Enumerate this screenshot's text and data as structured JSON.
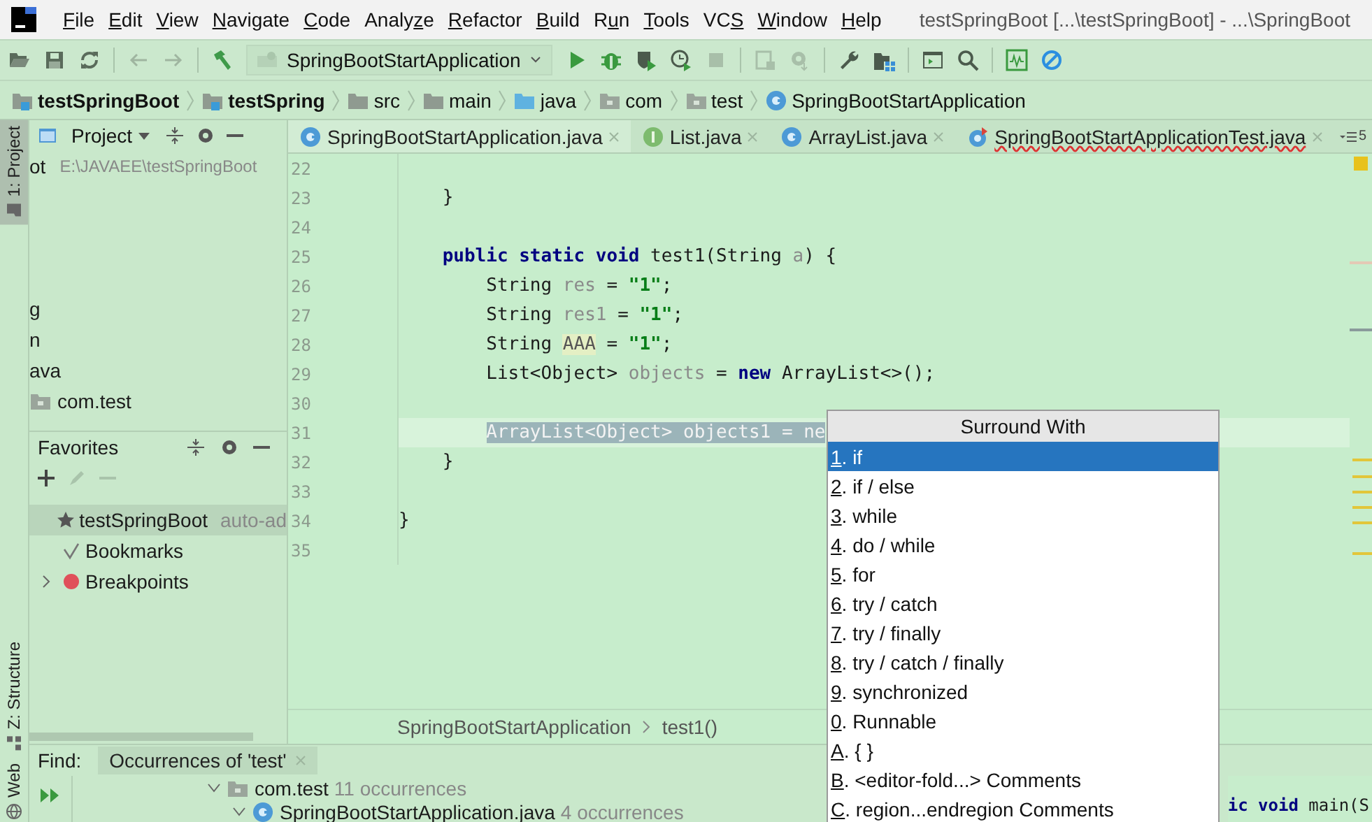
{
  "window": {
    "title": "testSpringBoot [...\\testSpringBoot] - ...\\SpringBoot"
  },
  "menu": [
    {
      "key": "F",
      "after": "ile"
    },
    {
      "key": "E",
      "after": "dit"
    },
    {
      "key": "V",
      "after": "iew"
    },
    {
      "key": "N",
      "after": "avigate"
    },
    {
      "key": "C",
      "after": "ode"
    },
    {
      "before": "Analy",
      "key": "z",
      "after": "e"
    },
    {
      "key": "R",
      "after": "efactor"
    },
    {
      "key": "B",
      "after": "uild"
    },
    {
      "before": "R",
      "key": "u",
      "after": "n"
    },
    {
      "key": "T",
      "after": "ools"
    },
    {
      "before": "VC",
      "key": "S"
    },
    {
      "key": "W",
      "after": "indow"
    },
    {
      "key": "H",
      "after": "elp"
    }
  ],
  "toolbar": {
    "run_config": "SpringBootStartApplication"
  },
  "breadcrumbs": [
    {
      "label": "testSpringBoot",
      "kind": "module"
    },
    {
      "label": "testSpring",
      "kind": "module"
    },
    {
      "label": "src",
      "kind": "folder"
    },
    {
      "label": "main",
      "kind": "folder"
    },
    {
      "label": "java",
      "kind": "source"
    },
    {
      "label": "com",
      "kind": "package"
    },
    {
      "label": "test",
      "kind": "package"
    },
    {
      "label": "SpringBootStartApplication",
      "kind": "class"
    }
  ],
  "tool_stripe": [
    {
      "label": "1: Project",
      "at_bottom": false,
      "selected": true
    },
    {
      "label": "Z: Structure",
      "at_bottom": true,
      "selected": false
    },
    {
      "label": "Web",
      "at_bottom": true,
      "selected": false
    }
  ],
  "project_panel": {
    "title": "Project",
    "rows": [
      {
        "name": "ot",
        "path": "E:\\JAVAEE\\testSpringBoot"
      },
      {
        "name": "g"
      },
      {
        "name": "n"
      },
      {
        "name": "ava"
      },
      {
        "name": "com.test",
        "kind": "package"
      }
    ]
  },
  "favorites": {
    "title": "Favorites",
    "items": [
      {
        "label": "testSpringBoot",
        "note": "auto-ad",
        "kind": "star",
        "selected": true
      },
      {
        "label": "Bookmarks",
        "kind": "check",
        "selected": false
      },
      {
        "label": "Breakpoints",
        "kind": "breakpoint",
        "selected": false,
        "expanded": false
      }
    ]
  },
  "editor": {
    "tabs": [
      {
        "label": "SpringBootStartApplication.java",
        "kind": "class",
        "selected": true,
        "has_errors": false
      },
      {
        "label": "List.java",
        "kind": "interface",
        "selected": false,
        "has_errors": false
      },
      {
        "label": "ArrayList.java",
        "kind": "class",
        "selected": false,
        "has_errors": false
      },
      {
        "label": "SpringBootStartApplicationTest.java",
        "kind": "test",
        "selected": false,
        "has_errors": true
      }
    ],
    "hidden_tabs": "5",
    "lines": [
      {
        "number": "22",
        "current": false
      },
      {
        "number": "23",
        "current": false,
        "tokens": [
          {
            "text": "    }",
            "kind": "plain"
          }
        ]
      },
      {
        "number": "24",
        "current": false
      },
      {
        "number": "25",
        "current": false,
        "tokens": [
          {
            "text": "    public static void",
            "kind": "keyword"
          },
          {
            "text": " test1(String ",
            "kind": "plain"
          },
          {
            "text": "a",
            "kind": "unused"
          },
          {
            "text": ") {",
            "kind": "plain"
          }
        ]
      },
      {
        "number": "26",
        "current": false,
        "tokens": [
          {
            "text": "        String ",
            "kind": "plain"
          },
          {
            "text": "res",
            "kind": "unused"
          },
          {
            "text": " = ",
            "kind": "plain"
          },
          {
            "text": "\"1\"",
            "kind": "string"
          },
          {
            "text": ";",
            "kind": "plain"
          }
        ]
      },
      {
        "number": "27",
        "current": false,
        "tokens": [
          {
            "text": "        String ",
            "kind": "plain"
          },
          {
            "text": "res1",
            "kind": "unused"
          },
          {
            "text": " = ",
            "kind": "plain"
          },
          {
            "text": "\"1\"",
            "kind": "string"
          },
          {
            "text": ";",
            "kind": "plain"
          }
        ]
      },
      {
        "number": "28",
        "current": false,
        "tokens": [
          {
            "text": "        String ",
            "kind": "plain"
          },
          {
            "text": "AAA",
            "kind": "warning"
          },
          {
            "text": " = ",
            "kind": "plain"
          },
          {
            "text": "\"1\"",
            "kind": "string"
          },
          {
            "text": ";",
            "kind": "plain"
          }
        ]
      },
      {
        "number": "29",
        "current": false,
        "tokens": [
          {
            "text": "        List<Object> ",
            "kind": "plain"
          },
          {
            "text": "objects",
            "kind": "unused"
          },
          {
            "text": " = ",
            "kind": "plain"
          },
          {
            "text": "new",
            "kind": "keyword"
          },
          {
            "text": " ArrayList<>();",
            "kind": "plain"
          }
        ]
      },
      {
        "number": "30",
        "current": false
      },
      {
        "number": "31",
        "current": true,
        "tokens": [
          {
            "text": "        ArrayList<Object> objects1 = ne",
            "kind": "selected"
          }
        ]
      },
      {
        "number": "32",
        "current": false,
        "tokens": [
          {
            "text": "    }",
            "kind": "plain"
          }
        ]
      },
      {
        "number": "33",
        "current": false
      },
      {
        "number": "34",
        "current": false,
        "tokens": [
          {
            "text": "}",
            "kind": "plain"
          }
        ]
      },
      {
        "number": "35",
        "current": false
      }
    ],
    "breadcrumbs": [
      "SpringBootStartApplication",
      "test1()"
    ]
  },
  "popup": {
    "title": "Surround With",
    "items": [
      {
        "key": "1",
        "label": ". if",
        "selected": true
      },
      {
        "key": "2",
        "label": ". if / else",
        "selected": false
      },
      {
        "key": "3",
        "label": ". while",
        "selected": false
      },
      {
        "key": "4",
        "label": ". do / while",
        "selected": false
      },
      {
        "key": "5",
        "label": ". for",
        "selected": false
      },
      {
        "key": "6",
        "label": ". try / catch",
        "selected": false
      },
      {
        "key": "7",
        "label": ". try / finally",
        "selected": false
      },
      {
        "key": "8",
        "label": ". try / catch / finally",
        "selected": false
      },
      {
        "key": "9",
        "label": ". synchronized",
        "selected": false
      },
      {
        "key": "0",
        "label": ". Runnable",
        "selected": false
      },
      {
        "key": "A",
        "label": ". { }",
        "selected": false
      },
      {
        "key": "B",
        "label": ". <editor-fold...> Comments",
        "selected": false
      },
      {
        "key": "C",
        "label": ". region...endregion Comments",
        "selected": false
      }
    ]
  },
  "find_panel": {
    "label": "Find:",
    "tab": "Occurrences of 'test'",
    "rows": [
      {
        "label": "com.test",
        "count": "11 occurrences",
        "kind": "package"
      },
      {
        "label": "SpringBootStartApplication.java",
        "count": "4 occurrences",
        "kind": "class"
      }
    ],
    "preview": [
      {
        "text": "ic void",
        "kind": "keyword"
      },
      {
        "text": " main(S",
        "kind": "plain"
      }
    ]
  }
}
